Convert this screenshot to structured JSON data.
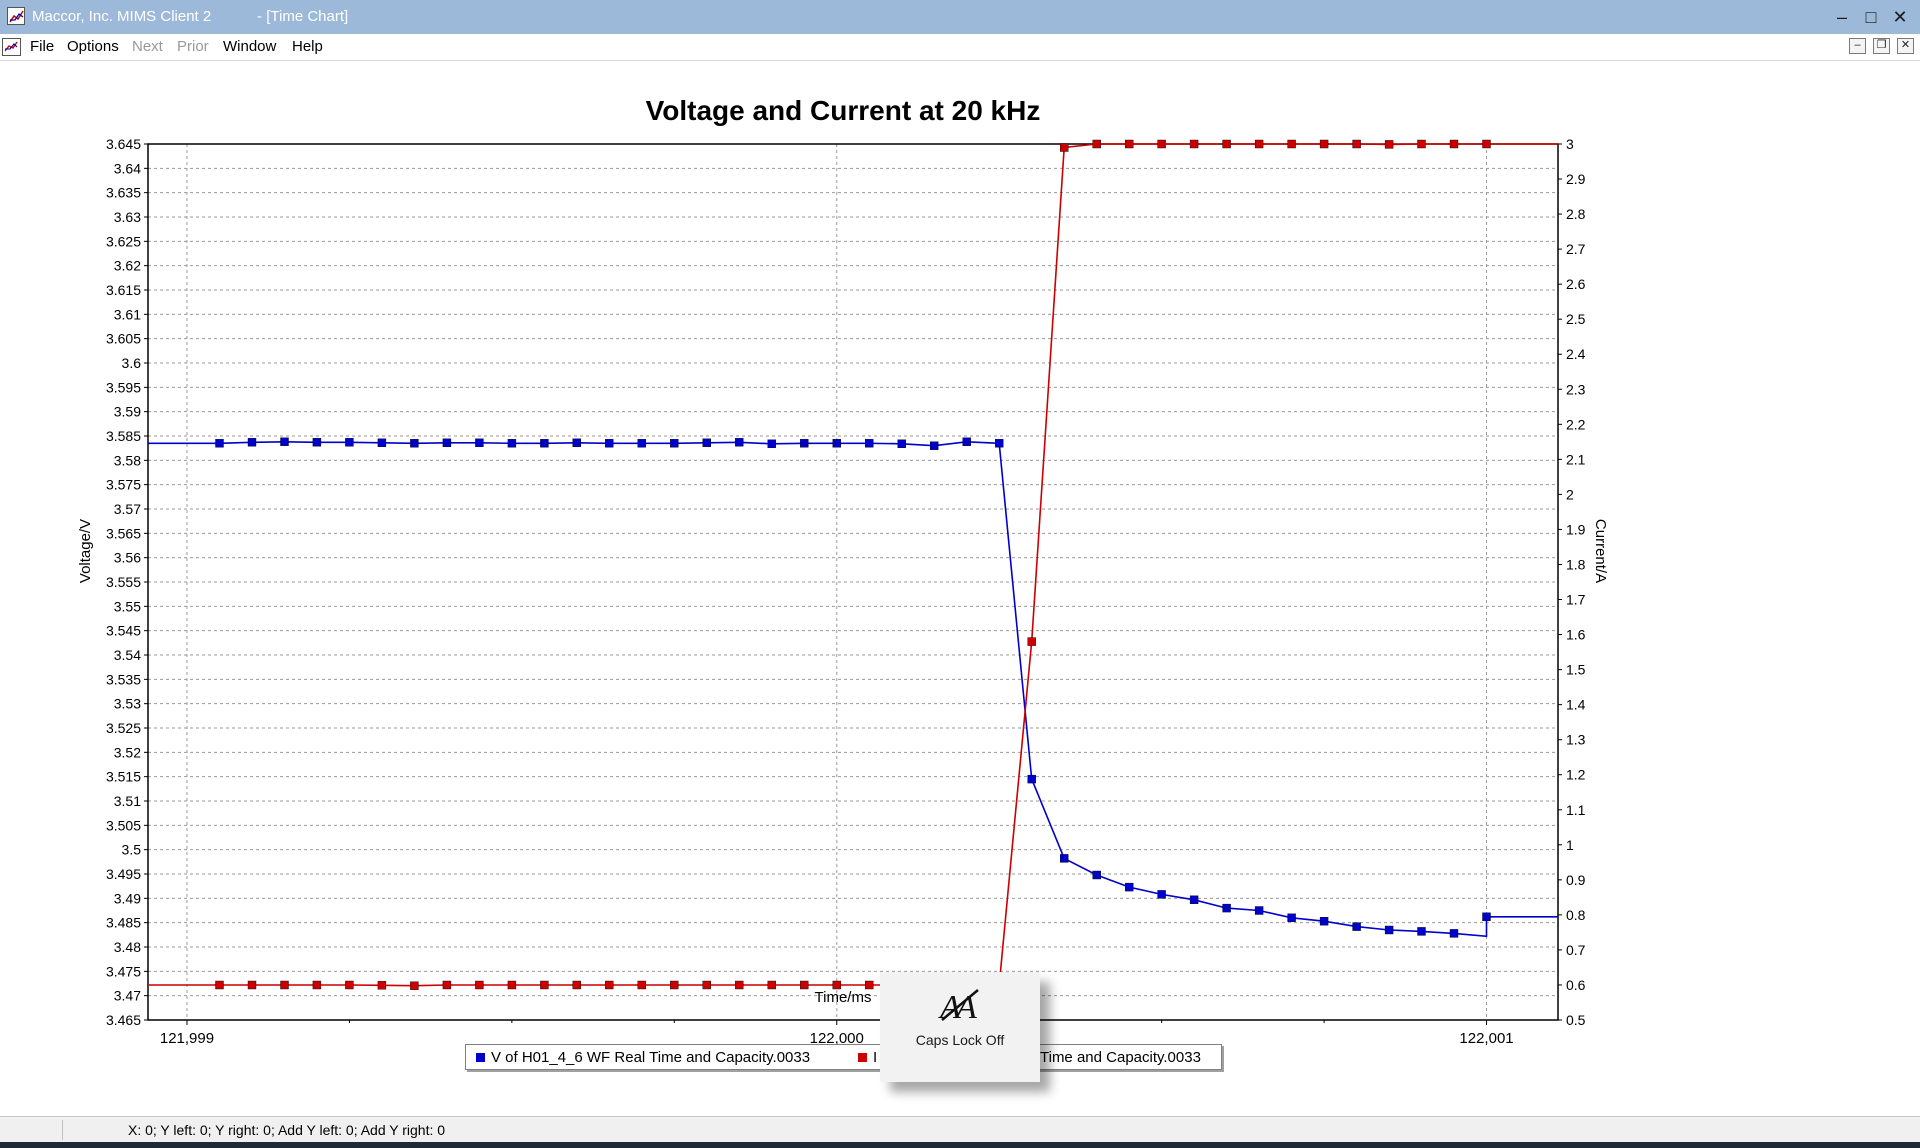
{
  "window": {
    "title": "Maccor, Inc. MIMS Client 2           - [Time Chart]",
    "controls": {
      "minimize": "–",
      "maximize": "□",
      "close": "✕"
    }
  },
  "menu": {
    "items": [
      {
        "label": "File",
        "enabled": true
      },
      {
        "label": "Options",
        "enabled": true
      },
      {
        "label": "Next",
        "enabled": false
      },
      {
        "label": "Prior",
        "enabled": false
      },
      {
        "label": "Window",
        "enabled": true
      },
      {
        "label": "Help",
        "enabled": true
      }
    ],
    "mdi_controls": {
      "minimize": "–",
      "restore": "❐",
      "close": "✕"
    }
  },
  "chart_data": {
    "type": "line",
    "title": "Voltage and Current at 20 kHz",
    "xlabel": "Time/ms",
    "ylabel_left": "Voltage/V",
    "ylabel_right": "Current/A",
    "xlim": [
      121998.94,
      122001.11
    ],
    "ylim_left": [
      3.465,
      3.645
    ],
    "ylim_right": [
      0.5,
      3.0
    ],
    "x_ticks": [
      121999,
      122000,
      122001
    ],
    "x_tick_labels": [
      "121,999",
      "122,000",
      "122,001"
    ],
    "y_left_ticks": [
      3.465,
      3.47,
      3.475,
      3.48,
      3.485,
      3.49,
      3.495,
      3.5,
      3.505,
      3.51,
      3.515,
      3.52,
      3.525,
      3.53,
      3.535,
      3.54,
      3.545,
      3.55,
      3.555,
      3.56,
      3.565,
      3.57,
      3.575,
      3.58,
      3.585,
      3.59,
      3.595,
      3.6,
      3.605,
      3.61,
      3.615,
      3.62,
      3.625,
      3.63,
      3.635,
      3.64,
      3.645
    ],
    "y_right_ticks": [
      0.5,
      0.6,
      0.7,
      0.8,
      0.9,
      1,
      1.1,
      1.2,
      1.3,
      1.4,
      1.5,
      1.6,
      1.7,
      1.8,
      1.9,
      2,
      2.1,
      2.2,
      2.3,
      2.4,
      2.5,
      2.6,
      2.7,
      2.8,
      2.9,
      3
    ],
    "grid": true,
    "legend_position": "bottom-center",
    "series": [
      {
        "name": "V of H01_4_6 WF Real Time and Capacity.0033",
        "axis": "left",
        "color": "#0000cc",
        "x": [
          121998.94,
          121999.05,
          121999.1,
          121999.15,
          121999.2,
          121999.25,
          121999.3,
          121999.35,
          121999.4,
          121999.45,
          121999.5,
          121999.55,
          121999.6,
          121999.65,
          121999.7,
          121999.75,
          121999.8,
          121999.85,
          121999.9,
          121999.95,
          122000.0,
          122000.05,
          122000.1,
          122000.15,
          122000.2,
          122000.25,
          122000.3,
          122000.35,
          122000.4,
          122000.45,
          122000.5,
          122000.55,
          122000.6,
          122000.65,
          122000.7,
          122000.75,
          122000.8,
          122000.85,
          122000.9,
          122000.95,
          122001.0,
          122001.0,
          122001.11
        ],
        "y": [
          3.5835,
          3.5835,
          3.5837,
          3.5838,
          3.5837,
          3.5837,
          3.5836,
          3.5835,
          3.5836,
          3.5836,
          3.5835,
          3.5835,
          3.5836,
          3.5835,
          3.5835,
          3.5835,
          3.5836,
          3.5837,
          3.5834,
          3.5835,
          3.5835,
          3.5835,
          3.5834,
          3.583,
          3.5838,
          3.5835,
          3.5145,
          3.4982,
          3.4948,
          3.4923,
          3.4908,
          3.4897,
          3.488,
          3.4875,
          3.486,
          3.4853,
          3.4842,
          3.4835,
          3.4832,
          3.4828,
          3.4822,
          3.4862,
          3.4862
        ],
        "markers_hidden_at": [
          0,
          40,
          42
        ]
      },
      {
        "name": "I of H01_4_6 WF Real Time and Capacity.0033",
        "axis": "right",
        "color": "#cc0000",
        "x": [
          121998.94,
          121999.05,
          121999.1,
          121999.15,
          121999.2,
          121999.25,
          121999.3,
          121999.35,
          121999.4,
          121999.45,
          121999.5,
          121999.55,
          121999.6,
          121999.65,
          121999.7,
          121999.75,
          121999.8,
          121999.85,
          121999.9,
          121999.95,
          122000.0,
          122000.05,
          122000.1,
          122000.15,
          122000.2,
          122000.25,
          122000.3,
          122000.35,
          122000.4,
          122000.45,
          122000.5,
          122000.55,
          122000.6,
          122000.65,
          122000.7,
          122000.75,
          122000.8,
          122000.85,
          122000.9,
          122000.95,
          122001.0,
          122001.11
        ],
        "y": [
          0.6,
          0.6,
          0.6,
          0.6,
          0.6,
          0.6,
          0.599,
          0.598,
          0.6,
          0.6,
          0.6,
          0.6,
          0.6,
          0.6,
          0.6,
          0.6,
          0.6,
          0.6,
          0.6,
          0.6,
          0.6,
          0.6,
          0.6,
          0.598,
          0.6,
          0.6,
          1.58,
          2.99,
          3.0,
          3.0,
          3.0,
          3.0,
          3.0,
          3.0,
          3.0,
          3.0,
          3.0,
          2.999,
          3.0,
          3.0,
          3.0,
          3.0
        ],
        "markers_hidden_at": [
          0,
          41
        ]
      }
    ]
  },
  "legend": {
    "entries": [
      {
        "label": "V of H01_4_6 WF Real Time and Capacity.0033",
        "color": "#0000cc"
      },
      {
        "label": "I",
        "color": "#cc0000"
      },
      {
        "label": "Time and Capacity.0033",
        "color": ""
      }
    ]
  },
  "toast": {
    "text": "Caps Lock Off",
    "icon": "caps-lock-off-icon"
  },
  "statusbar": {
    "text": "X: 0; Y left: 0; Y right: 0; Add Y left: 0; Add Y right: 0"
  }
}
